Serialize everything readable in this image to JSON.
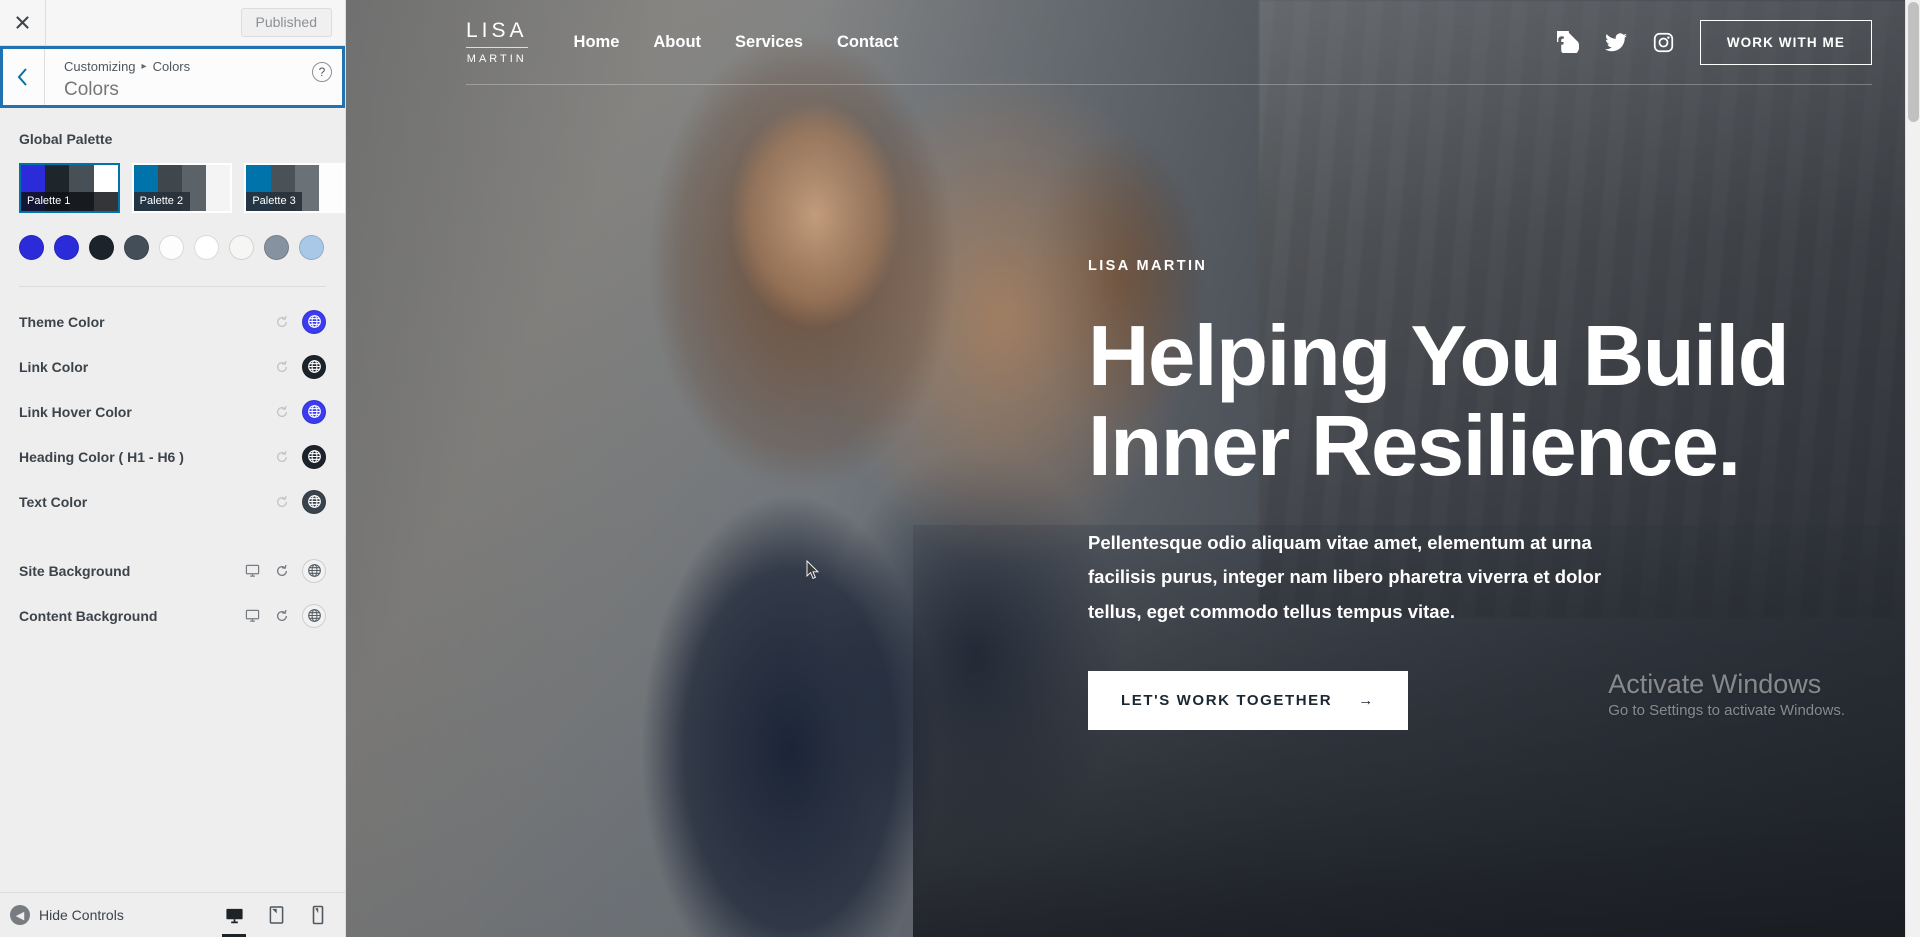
{
  "customizer": {
    "close_label": "✕",
    "publish_label": "Published",
    "breadcrumb_root": "Customizing",
    "breadcrumb_sep": "▸",
    "breadcrumb_current": "Colors",
    "panel_title": "Colors",
    "help_label": "?",
    "global_palette_label": "Global Palette",
    "palettes": [
      {
        "name": "Palette 1",
        "selected": true,
        "colors": [
          "#2b2bd9",
          "#1e252b",
          "#474f57",
          "#ffffff"
        ]
      },
      {
        "name": "Palette 2",
        "selected": false,
        "colors": [
          "#0073aa",
          "#3f474d",
          "#5b6368",
          "#f4f4f4"
        ]
      },
      {
        "name": "Palette 3",
        "selected": false,
        "colors": [
          "#0073aa",
          "#4a5157",
          "#6a7177",
          "#fdfdfd"
        ]
      }
    ],
    "palette_swatches": [
      {
        "name": "swatch-1",
        "color": "#2b2bd9"
      },
      {
        "name": "swatch-2",
        "color": "#2b2bd9"
      },
      {
        "name": "swatch-3",
        "color": "#1c232b"
      },
      {
        "name": "swatch-4",
        "color": "#444e58"
      },
      {
        "name": "swatch-5",
        "color": "#fdfdfd"
      },
      {
        "name": "swatch-6",
        "color": "#ffffff"
      },
      {
        "name": "swatch-7",
        "color": "#f6f6f4"
      },
      {
        "name": "swatch-8",
        "color": "#8792a0"
      },
      {
        "name": "swatch-9",
        "color": "#a9c8e8"
      }
    ],
    "controls_group_1": [
      {
        "label": "Theme Color",
        "swatch": "#3b3bf0",
        "has_reset": true,
        "has_device": false
      },
      {
        "label": "Link Color",
        "swatch": "#1c232b",
        "has_reset": true,
        "has_device": false
      },
      {
        "label": "Link Hover Color",
        "swatch": "#3b3bf0",
        "has_reset": true,
        "has_device": false
      },
      {
        "label": "Heading Color ( H1 - H6 )",
        "swatch": "#1c232b",
        "has_reset": true,
        "has_device": false
      },
      {
        "label": "Text Color",
        "swatch": "#3a434c",
        "has_reset": true,
        "has_device": false
      }
    ],
    "controls_group_2": [
      {
        "label": "Site Background",
        "swatch": "#f2f2f2",
        "has_reset": true,
        "has_device": true
      },
      {
        "label": "Content Background",
        "swatch": "#f2f2f2",
        "has_reset": true,
        "has_device": true
      }
    ],
    "footer": {
      "hide_controls_label": "Hide Controls",
      "devices": [
        {
          "name": "desktop-preview-button",
          "active": true
        },
        {
          "name": "tablet-preview-button",
          "active": false
        },
        {
          "name": "mobile-preview-button",
          "active": false
        }
      ]
    }
  },
  "preview": {
    "brand": {
      "line1": "LISA",
      "line2": "MARTIN"
    },
    "nav": [
      {
        "label": "Home"
      },
      {
        "label": "About"
      },
      {
        "label": "Services"
      },
      {
        "label": "Contact"
      }
    ],
    "socials": [
      {
        "name": "facebook-icon"
      },
      {
        "name": "twitter-icon"
      },
      {
        "name": "instagram-icon"
      }
    ],
    "header_cta": "WORK WITH ME",
    "hero": {
      "eyebrow": "LISA MARTIN",
      "heading_line1": "Helping You Build",
      "heading_line2": "Inner Resilience.",
      "paragraph": "Pellentesque odio aliquam vitae amet, elementum at urna facilisis purus, integer nam libero pharetra viverra et dolor tellus, eget commodo tellus tempus vitae.",
      "button_label": "LET'S WORK TOGETHER",
      "button_arrow": "→"
    }
  },
  "watermark": {
    "line1": "Activate Windows",
    "line2": "Go to Settings to activate Windows."
  }
}
